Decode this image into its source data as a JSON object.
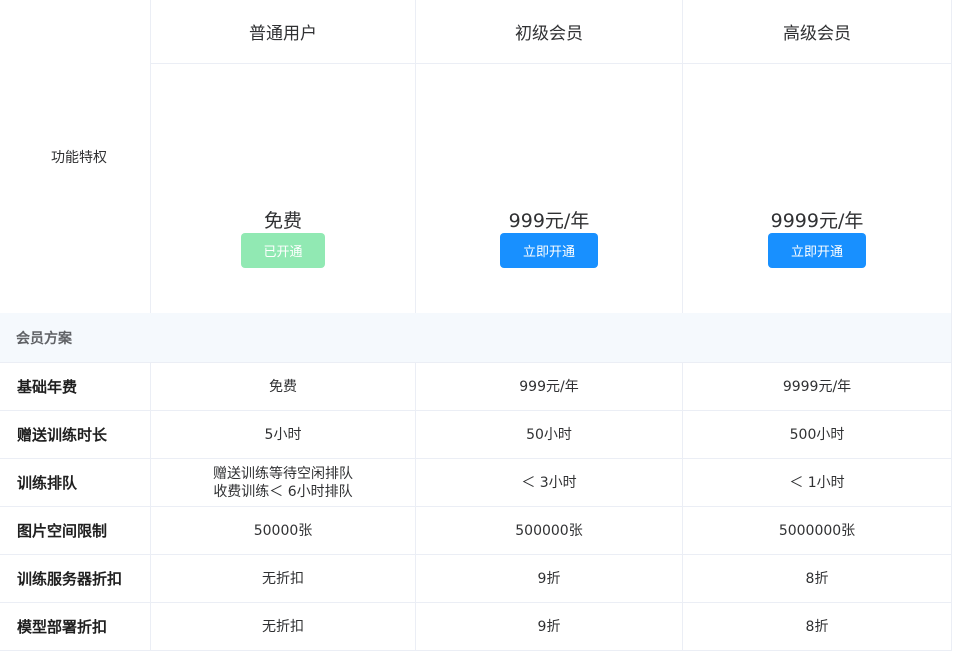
{
  "header": {
    "feature_label": "功能特权",
    "plans": [
      {
        "name": "普通用户",
        "price": "免费",
        "button": "已开通"
      },
      {
        "name": "初级会员",
        "price": "999元/年",
        "button": "立即开通"
      },
      {
        "name": "高级会员",
        "price": "9999元/年",
        "button": "立即开通"
      }
    ]
  },
  "section_title": "会员方案",
  "rows": [
    {
      "label": "基础年费",
      "values": [
        "免费",
        "999元/年",
        "9999元/年"
      ]
    },
    {
      "label": "赠送训练时长",
      "values": [
        "5小时",
        "50小时",
        "500小时"
      ]
    },
    {
      "label": "训练排队",
      "values": [
        "赠送训练等待空闲排队",
        "＜ 3小时",
        "＜ 1小时"
      ],
      "extra": "收费训练＜ 6小时排队"
    },
    {
      "label": "图片空间限制",
      "values": [
        "50000张",
        "500000张",
        "5000000张"
      ]
    },
    {
      "label": "训练服务器折扣",
      "values": [
        "无折扣",
        "9折",
        "8折"
      ]
    },
    {
      "label": "模型部署折扣",
      "values": [
        "无折扣",
        "9折",
        "8折"
      ]
    }
  ],
  "colors": {
    "border": "#ebeef5",
    "primary": "#1890ff",
    "disabled_green": "#91e9b3",
    "section_bg": "#f5f9fd"
  }
}
